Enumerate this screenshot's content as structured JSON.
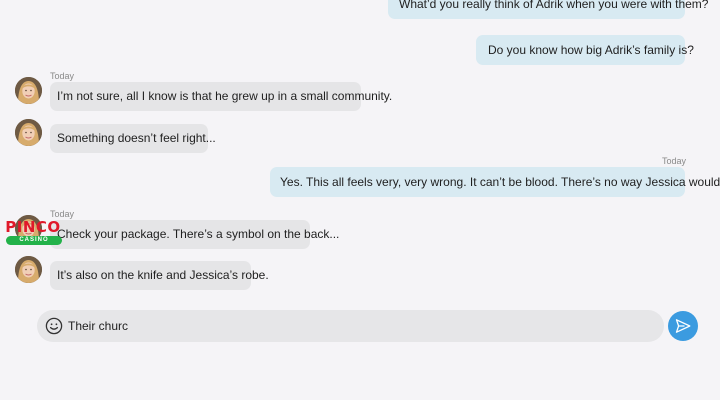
{
  "conversation": {
    "messages": [
      {
        "direction": "outgoing",
        "text": "What’d you really think of Adrik when you were with them?"
      },
      {
        "direction": "outgoing",
        "text": "Do you know how big Adrik’s family is?"
      },
      {
        "direction": "incoming",
        "timestamp": "Today",
        "text": "I’m not sure, all I know is that he grew up in a small community."
      },
      {
        "direction": "incoming",
        "text": "Something doesn’t feel right..."
      },
      {
        "direction": "outgoing",
        "timestamp": "Today",
        "text": "Yes. This all feels very, very wrong. It can’t be blood. There’s no way Jessica would..."
      },
      {
        "direction": "incoming",
        "timestamp": "Today",
        "text": "Check your package. There’s a symbol on the back..."
      },
      {
        "direction": "incoming",
        "text": "It’s also on the knife and Jessica’s robe."
      }
    ]
  },
  "composer": {
    "value": "Their churc",
    "emoji_icon": "smiley-face-icon",
    "send_icon": "paper-plane-icon",
    "send_color": "#3b9be0"
  },
  "overlay_logo": {
    "word": "PINCO",
    "tagline": "CASINO"
  },
  "colors": {
    "outgoing_bubble": "#d8eaf2",
    "incoming_bubble": "#e5e5e7",
    "background": "#f5f4f7"
  }
}
